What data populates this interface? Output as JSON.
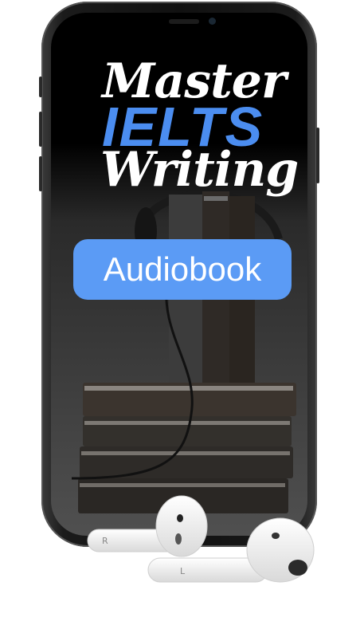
{
  "cover": {
    "title_line1": "Master",
    "title_line2": "IELTS",
    "title_line3": "Writing",
    "badge_label": "Audiobook"
  },
  "earbuds": {
    "left_marking": "R",
    "right_marking": "L"
  },
  "colors": {
    "accent": "#4b8df0",
    "badge": "#5b9bf5",
    "background": "#ffffff"
  }
}
